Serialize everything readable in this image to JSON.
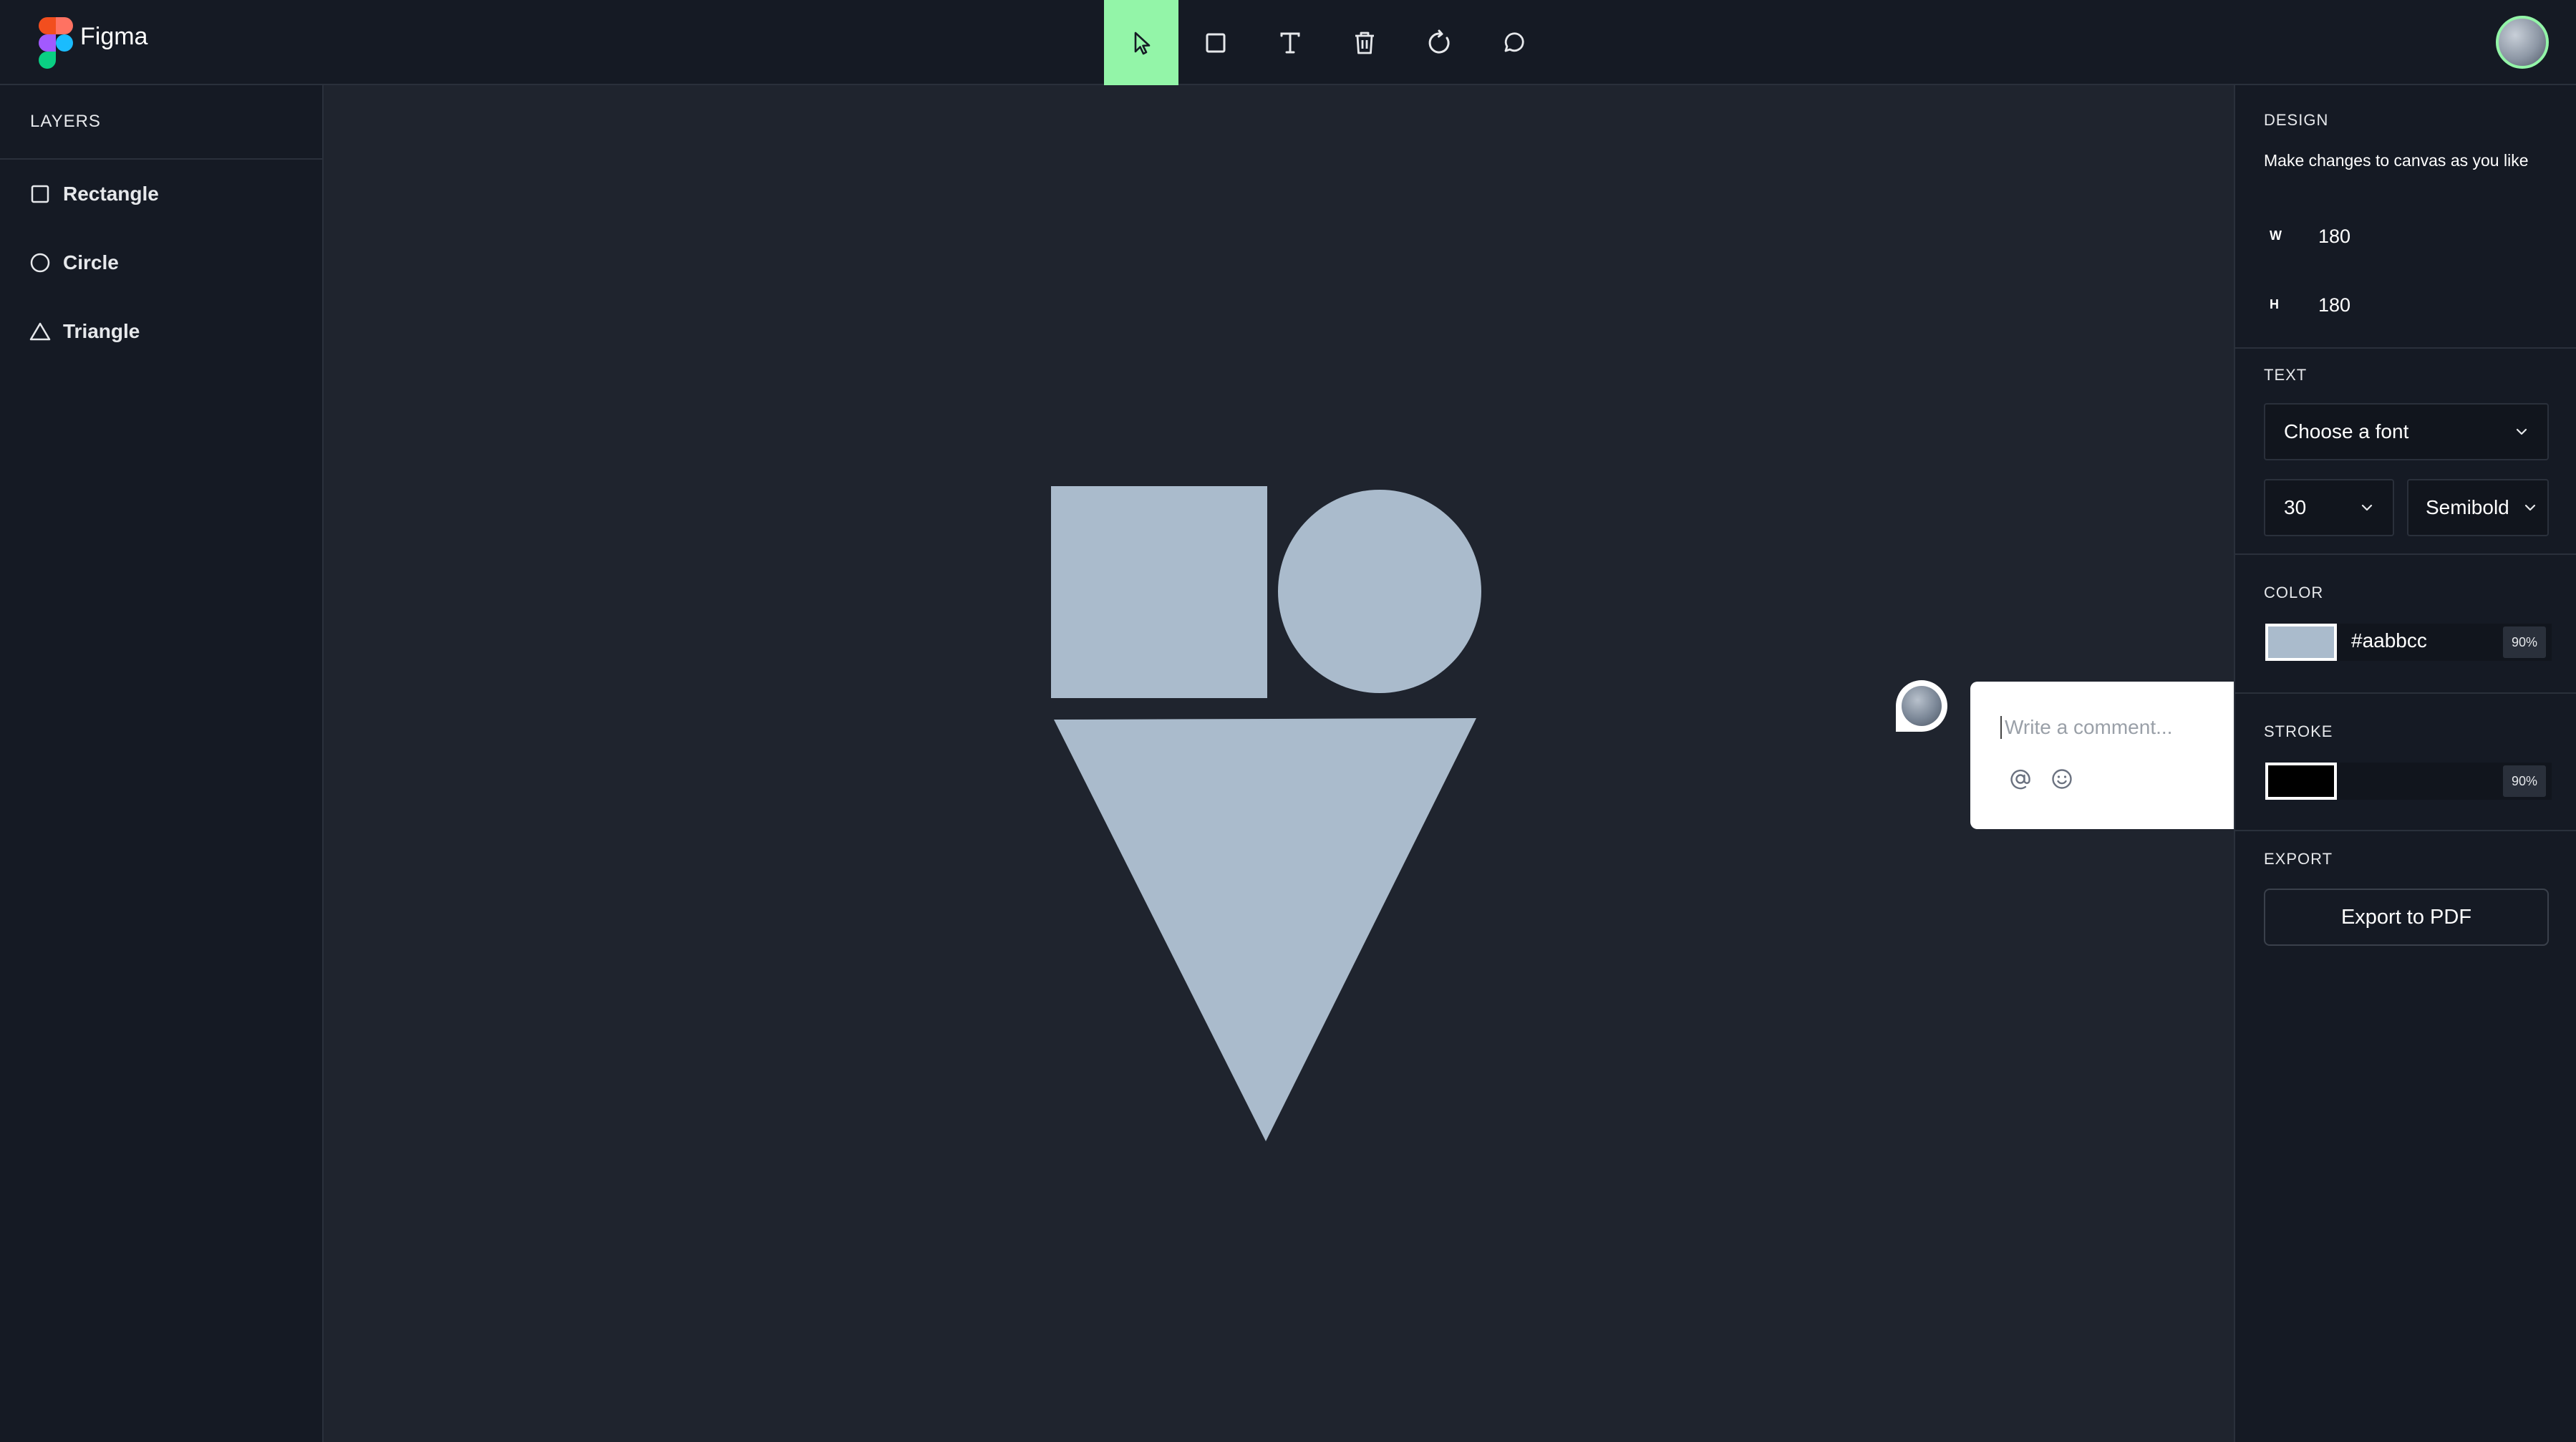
{
  "app": {
    "name": "Figma"
  },
  "toolbar": {
    "tools": [
      {
        "name": "select-tool",
        "icon": "cursor-arrow-icon",
        "active": true
      },
      {
        "name": "rectangle-tool",
        "icon": "square-icon",
        "active": false
      },
      {
        "name": "text-tool",
        "icon": "text-t-icon",
        "active": false
      },
      {
        "name": "delete-tool",
        "icon": "trash-icon",
        "active": false
      },
      {
        "name": "reset-tool",
        "icon": "rotate-icon",
        "active": false
      },
      {
        "name": "comment-tool",
        "icon": "speech-bubble-icon",
        "active": false
      }
    ],
    "active_color": "#93f5a8"
  },
  "layers": {
    "title": "LAYERS",
    "items": [
      {
        "label": "Rectangle",
        "icon": "square-outline-icon"
      },
      {
        "label": "Circle",
        "icon": "circle-outline-icon"
      },
      {
        "label": "Triangle",
        "icon": "triangle-outline-icon"
      }
    ]
  },
  "canvas": {
    "shape_fill": "#aabbcc",
    "background": "#1f242e",
    "comment": {
      "placeholder": "Write a comment...",
      "icons": [
        "at-sign-icon",
        "smiley-icon"
      ],
      "send_icon": "send-arrow-icon",
      "send_color": "#8aaaf5"
    }
  },
  "design": {
    "title": "DESIGN",
    "description": "Make changes to canvas as you like",
    "width": {
      "label": "W",
      "value": "180"
    },
    "height": {
      "label": "H",
      "value": "180"
    },
    "text": {
      "title": "TEXT",
      "font_placeholder": "Choose a font",
      "size": "30",
      "weight": "Semibold"
    },
    "color": {
      "title": "COLOR",
      "hex": "#aabbcc",
      "opacity": "90%",
      "swatch": "#aabbcc"
    },
    "stroke": {
      "title": "STROKE",
      "opacity": "90%",
      "swatch": "#000000"
    },
    "export": {
      "title": "EXPORT",
      "button_label": "Export to PDF"
    }
  }
}
